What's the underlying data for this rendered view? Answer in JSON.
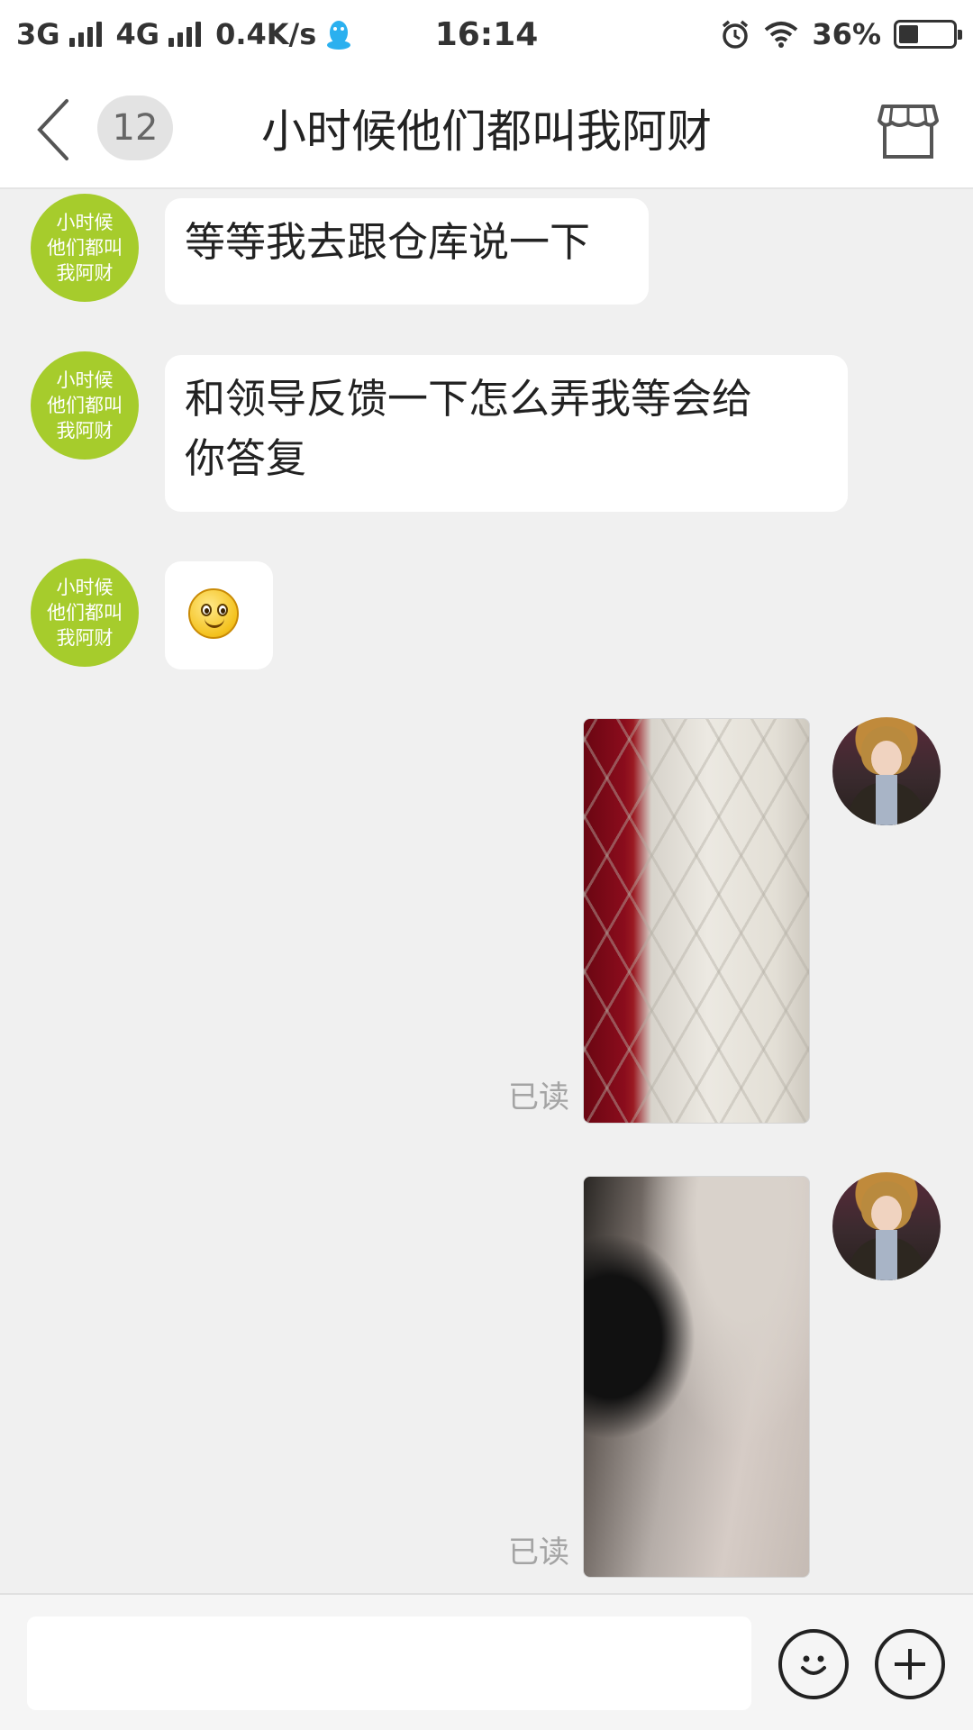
{
  "status_bar": {
    "network_1": "3G",
    "network_2": "4G",
    "speed": "0.4K/s",
    "time": "16:14",
    "battery_text": "36%",
    "battery_level": 0.36,
    "icons": [
      "qq-penguin-icon",
      "alarm-icon",
      "wifi-icon",
      "battery-icon"
    ]
  },
  "header": {
    "back_icon": "chevron-left-icon",
    "unread_count": "12",
    "title": "小时候他们都叫我阿财",
    "shop_icon": "store-icon"
  },
  "avatar_text": [
    "小时候",
    "他们都叫",
    "我阿财"
  ],
  "messages": [
    {
      "side": "in",
      "type": "text",
      "text": "等等我去跟仓库说一下"
    },
    {
      "side": "in",
      "type": "text",
      "lines": [
        "和领导反馈一下怎么弄我等会给",
        "你答复"
      ]
    },
    {
      "side": "in",
      "type": "emoji",
      "emoji": "smile-emoji"
    },
    {
      "side": "out",
      "type": "image",
      "image": "red-bag-quilted-lining-photo",
      "status": "已读"
    },
    {
      "side": "out",
      "type": "image",
      "image": "bag-interior-fabric-photo",
      "status": "已读"
    }
  ],
  "input_bar": {
    "placeholder": "",
    "emoji_icon": "smiley-face-icon",
    "plus_icon": "plus-icon"
  },
  "colors": {
    "avatar_green": "#a6cc2c",
    "background": "#f0f0f0",
    "bubble": "#ffffff",
    "read_text": "#a4a4a4"
  }
}
